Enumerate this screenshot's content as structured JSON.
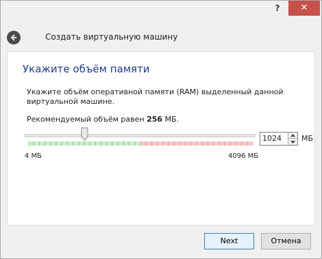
{
  "titlebar": {
    "help_label": "?",
    "close_label": "✕"
  },
  "header": {
    "title": "Создать виртуальную машину"
  },
  "page": {
    "title": "Укажите объём памяти",
    "description": "Укажите объём оперативной памяти (RAM) выделенный данной виртуальной машине.",
    "recommended_prefix": "Рекомендуемый объём равен ",
    "recommended_value": "256",
    "recommended_suffix": " МБ."
  },
  "slider": {
    "min_label": "4 МБ",
    "max_label": "4096 МБ",
    "min": 4,
    "max": 4096,
    "value": 1024,
    "safe_fraction": 0.5,
    "colors": {
      "safe": "#c9f0c9",
      "unsafe": "#f7c9c9"
    }
  },
  "memory_input": {
    "value": "1024",
    "unit": "МБ"
  },
  "buttons": {
    "next": "Next",
    "cancel": "Отмена"
  },
  "colors": {
    "title_accent": "#1c3c8e",
    "close_button": "#c7504b"
  }
}
